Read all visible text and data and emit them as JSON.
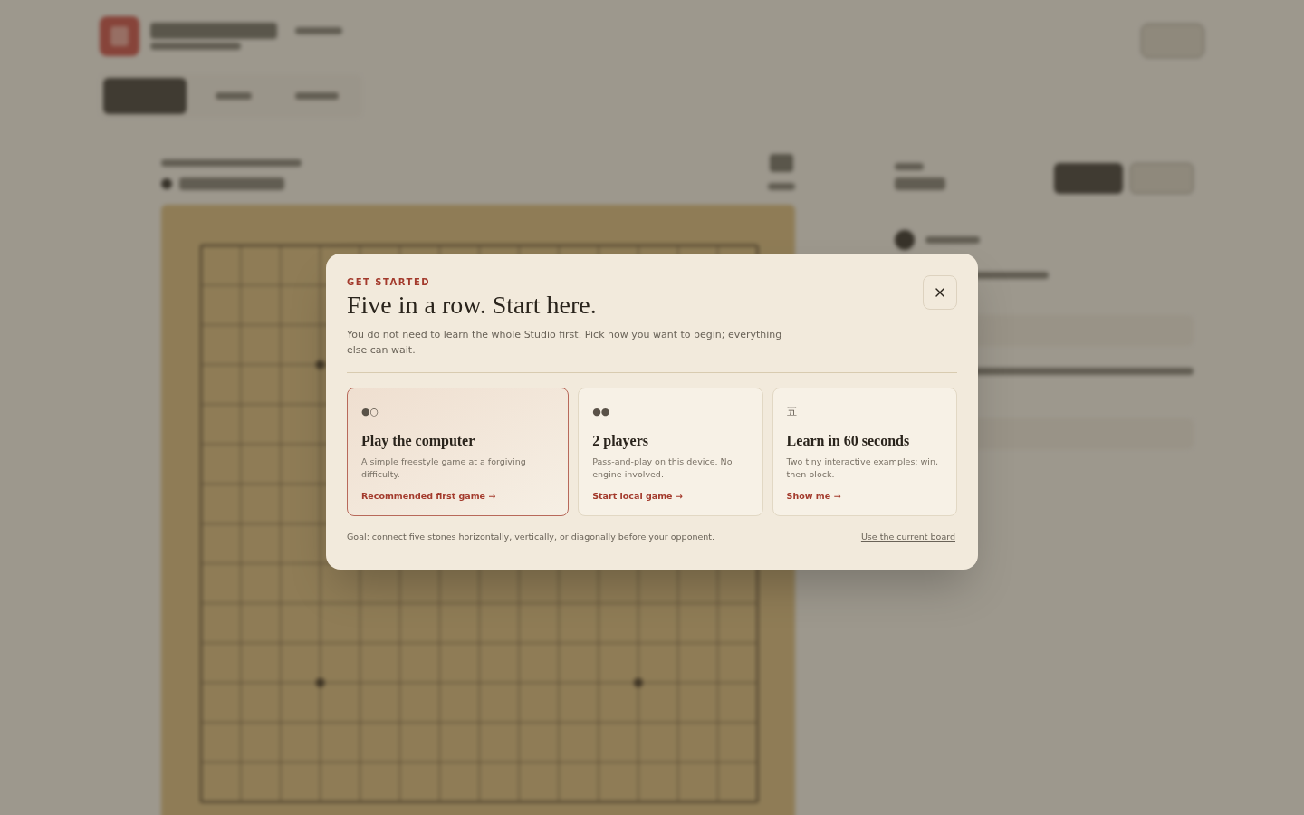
{
  "dialog": {
    "eyebrow": "GET STARTED",
    "title": "Five in a row. Start here.",
    "description": "You do not need to learn the whole Studio first. Pick how you want to begin; everything else can wait.",
    "options": [
      {
        "icon": "●○",
        "title": "Play the computer",
        "description": "A simple freestyle game at a forgiving difficulty.",
        "action": "Recommended first game →",
        "selected": true
      },
      {
        "icon": "●●",
        "title": "2 players",
        "description": "Pass-and-play on this device. No engine involved.",
        "action": "Start local game →",
        "selected": false
      },
      {
        "icon": "五",
        "title": "Learn in 60 seconds",
        "description": "Two tiny interactive examples: win, then block.",
        "action": "Show me →",
        "selected": false
      }
    ],
    "goal": "Goal: connect five stones horizontally, vertically, or diagonally before your opponent.",
    "link": "Use the current board"
  }
}
